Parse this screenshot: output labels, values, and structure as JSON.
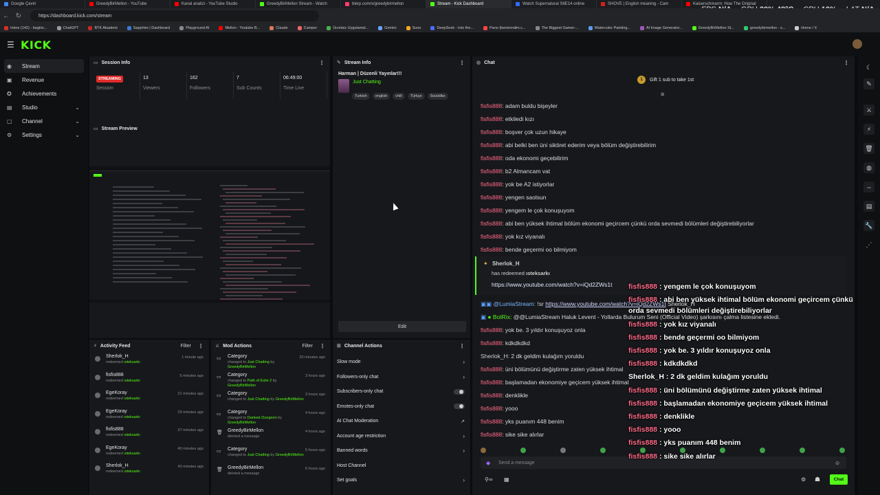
{
  "browser": {
    "tabs": [
      {
        "label": "Google Çeviri",
        "color": "#4285f4",
        "active": false
      },
      {
        "label": "GreedyBirMellon - YouTube",
        "color": "#ff0000",
        "active": false
      },
      {
        "label": "Kanal analizi - YouTube Studio",
        "color": "#ff0000",
        "active": false
      },
      {
        "label": "GreedyBirMellon Stream - Watch",
        "color": "#53fc18",
        "active": false
      },
      {
        "label": "blerp.com/x/greedybirmellon",
        "color": "#ff3d6a",
        "active": false
      },
      {
        "label": "Stream - Kick Dashboard",
        "color": "#53fc18",
        "active": true
      },
      {
        "label": "Watch Supernatural S6E14 online",
        "color": "#2c6cff",
        "active": false
      },
      {
        "label": "SHOVE | English meaning - Cam",
        "color": "#d02020",
        "active": false
      },
      {
        "label": "Kaiserschmarrn: How The Original",
        "color": "#ff0000",
        "active": false
      }
    ],
    "url": "https://dashboard.kick.com/stream",
    "bookmarks": [
      {
        "label": "Inbox (142) - bagiris...",
        "color": "#d93025"
      },
      {
        "label": "ChatGPT",
        "color": "#9a9a9a"
      },
      {
        "label": "BTK Akademi",
        "color": "#c62828"
      },
      {
        "label": "Sapphire | Dashboard",
        "color": "#3a7bd5"
      },
      {
        "label": "Playground AI",
        "color": "#888888"
      },
      {
        "label": "Mellon - Youtube B...",
        "color": "#ff0000"
      },
      {
        "label": "Claude",
        "color": "#d97757"
      },
      {
        "label": "Camper",
        "color": "#e66"
      },
      {
        "label": "Ücretsiz Uygulamal...",
        "color": "#4caf50"
      },
      {
        "label": "Gemini",
        "color": "#6aa0ff"
      },
      {
        "label": "Suno",
        "color": "#f5a623"
      },
      {
        "label": "DeepSeek - Into the...",
        "color": "#4d6bfe"
      },
      {
        "label": "Pano (bentrendim.c...",
        "color": "#ff4444"
      },
      {
        "label": "The Biggest Gamer-...",
        "color": "#888888"
      },
      {
        "label": "Watercolor Painting...",
        "color": "#5c9ded"
      },
      {
        "label": "AI Image Generator...",
        "color": "#9b59b6"
      },
      {
        "label": "GreedyBirMellon St...",
        "color": "#53fc18"
      },
      {
        "label": "greedybirmellon - s...",
        "color": "#2ecc71"
      },
      {
        "label": "Home / X",
        "color": "#cccccc"
      }
    ],
    "perf": {
      "fps_label": "FPS",
      "fps": "N/A",
      "gpu_label": "GPU",
      "gpu": "20% 48°C",
      "cpu_label": "CPU",
      "cpu": "10%",
      "lat_label": "LAT",
      "lat": "N/A"
    }
  },
  "app": {
    "logo": "KICK"
  },
  "sidebar": {
    "items": [
      {
        "label": "Stream",
        "icon": "broadcast-icon",
        "glyph": "◉",
        "chevron": false,
        "active": true
      },
      {
        "label": "Revenue",
        "icon": "revenue-icon",
        "glyph": "▣",
        "chevron": false,
        "active": false
      },
      {
        "label": "Achievements",
        "icon": "trophy-icon",
        "glyph": "✪",
        "chevron": false,
        "active": false
      },
      {
        "label": "Studio",
        "icon": "studio-icon",
        "glyph": "▤",
        "chevron": true,
        "active": false
      },
      {
        "label": "Channel",
        "icon": "channel-icon",
        "glyph": "▢",
        "chevron": true,
        "active": false
      },
      {
        "label": "Settings",
        "icon": "gear-icon",
        "glyph": "⚙",
        "chevron": true,
        "active": false
      }
    ]
  },
  "session": {
    "title": "Session Info",
    "status_badge": "STREAMING",
    "stats": [
      {
        "value": "",
        "label": "Session"
      },
      {
        "value": "13",
        "label": "Viewers"
      },
      {
        "value": "162",
        "label": "Followers"
      },
      {
        "value": "7",
        "label": "Sub Counts"
      },
      {
        "value": "06:49:00",
        "label": "Time Live"
      }
    ]
  },
  "preview": {
    "title": "Stream Preview"
  },
  "stream_info": {
    "title": "Stream Info",
    "stream_title": "Harman | Düzenli Yayınlar!!!",
    "category": "Just Chatting",
    "tags": [
      "Turkish",
      "english",
      "chill",
      "Türkçe",
      "Soulslike"
    ],
    "edit_label": "Edit"
  },
  "activity": {
    "title": "Activity Feed",
    "filter_label": "Filter",
    "rows": [
      {
        "name": "Sherlok_H",
        "action": "redeemed",
        "item": "ısteksarkı",
        "time": "1 minute ago"
      },
      {
        "name": "fisfis888",
        "action": "redeemed",
        "item": "ısteksarkı",
        "time": "5 minutes ago"
      },
      {
        "name": "EgeKoray",
        "action": "redeemed",
        "item": "ısteksarkı",
        "time": "21 minutes ago"
      },
      {
        "name": "EgeKoray",
        "action": "redeemed",
        "item": "ısteksarkı",
        "time": "29 minutes ago"
      },
      {
        "name": "fisfis888",
        "action": "redeemed",
        "item": "ısteksarkı",
        "time": "37 minutes ago"
      },
      {
        "name": "EgeKoray",
        "action": "redeemed",
        "item": "ısteksarkı",
        "time": "40 minutes ago"
      },
      {
        "name": "Sherlok_H",
        "action": "redeemed",
        "item": "ısteksarkı",
        "time": "43 minutes ago"
      }
    ]
  },
  "mod_actions": {
    "title": "Mod Actions",
    "filter_label": "Filter",
    "rows": [
      {
        "title": "Category",
        "pre": "changed to",
        "target": "Just Chatting",
        "mid": "by",
        "by": "GreedyBirMellon",
        "time": "20 minutes ago",
        "icon": "category-icon",
        "glyph": "▭"
      },
      {
        "title": "Category",
        "pre": "changed to",
        "target": "Path of Exile 2",
        "mid": "by",
        "by": "GreedyBirMellon",
        "time": "3 hours ago",
        "icon": "category-icon",
        "glyph": "▭"
      },
      {
        "title": "Category",
        "pre": "changed to",
        "target": "Just Chatting",
        "mid": "by",
        "by": "GreedyBirMellon",
        "time": "3 hours ago",
        "icon": "category-icon",
        "glyph": "▭"
      },
      {
        "title": "Category",
        "pre": "changed to",
        "target": "Darkest Dungeon",
        "mid": "by",
        "by": "GreedyBirMellon",
        "time": "4 hours ago",
        "icon": "category-icon",
        "glyph": "▭"
      },
      {
        "title": "GreedyBirMellon",
        "pre": "deleted a message",
        "target": "",
        "mid": "",
        "by": "",
        "time": "4 hours ago",
        "icon": "trash-icon",
        "glyph": "🗑"
      },
      {
        "title": "Category",
        "pre": "changed to",
        "target": "Just Chatting",
        "mid": "by",
        "by": "GreedyBirMellon",
        "time": "5 hours ago",
        "icon": "category-icon",
        "glyph": "▭"
      },
      {
        "title": "GreedyBirMellon",
        "pre": "deleted a message",
        "target": "",
        "mid": "",
        "by": "",
        "time": "6 hours ago",
        "icon": "trash-icon",
        "glyph": "🗑"
      }
    ]
  },
  "channel_actions": {
    "title": "Channel Actions",
    "rows": [
      {
        "label": "Slow mode",
        "control": "arrow"
      },
      {
        "label": "Followers-only chat",
        "control": "arrow"
      },
      {
        "label": "Subscribers-only chat",
        "control": "toggle"
      },
      {
        "label": "Emotes-only chat",
        "control": "toggle"
      },
      {
        "label": "AI Chat Moderation",
        "control": "external"
      },
      {
        "label": "Account age restriction",
        "control": "arrow"
      },
      {
        "label": "Banned words",
        "control": "arrow"
      },
      {
        "label": "Host Channel",
        "control": "none"
      },
      {
        "label": "Set goals",
        "control": "arrow"
      }
    ]
  },
  "chat": {
    "title": "Chat",
    "gift_count": "1",
    "gift_text": "Gift 1 sub to take 1st",
    "messages": [
      {
        "user": "fisfis888",
        "text": "adam buldu bişeyler"
      },
      {
        "user": "fisfis888",
        "text": "etkiledi kızı"
      },
      {
        "user": "fisfis888",
        "text": "boşver çok uzun hikaye"
      },
      {
        "user": "fisfis888",
        "text": "abi belki ben üni siktiret ederim veya bölüm değiştirebilirim"
      },
      {
        "user": "fisfis888",
        "text": "oda ekonomi geçebilirim"
      },
      {
        "user": "fisfis888",
        "text": "b2 Almancam vat"
      },
      {
        "user": "fisfis888",
        "text": "yok be A2 istiyorlar"
      },
      {
        "user": "fisfis888",
        "text": "yengen saolsun"
      },
      {
        "user": "fisfis888",
        "text": "yengem le çok konuşuyom"
      },
      {
        "user": "fisfis888",
        "text": "abi ben yüksek ihtimal bölüm ekonomi geçircem çünkü orda sevmedi bölümleri değiştirebiliyorlar"
      },
      {
        "user": "fisfis888",
        "text": "yok kız viyanalı"
      },
      {
        "user": "fisfis888",
        "text": "bende geçermi oo bilmiyom"
      }
    ],
    "redeem": {
      "user": "Sherlok_H",
      "line": "has redeemed",
      "reward": "ısteksarkı",
      "link": "https://www.youtube.com/watch?v=iQd2ZWs1t"
    },
    "lumia": {
      "user": "@LumiaStream:",
      "cmd": "!sr",
      "link": "https://www.youtube.com/watch?v=iQd2ZWs1t",
      "tail": "Sherlok_H"
    },
    "botrix": {
      "user": "BotRix:",
      "text": "@@LumiaStream Haluk Levent - Yollarda Bulurum Seni (Official Video) şarkısını çalma listesine ekledi."
    },
    "messages2": [
      {
        "user": "fisfis888",
        "text": "yok be. 3 yıldır konuşuyoz onla",
        "cls": "u"
      },
      {
        "user": "fisfis888",
        "text": "kdkdkdkd",
        "cls": "u"
      },
      {
        "user": "Sherlok_H:",
        "text": "2 dk geldim kulağım yoruldu",
        "cls": "u2"
      },
      {
        "user": "fisfis888",
        "text": "üni bölümünü değiştirme zaten yüksek ihtimal",
        "cls": "u"
      },
      {
        "user": "fisfis888",
        "text": "başlamadan ekonomiye geçicem yüksek ihtimal",
        "cls": "u"
      },
      {
        "user": "fisfis888",
        "text": "denklikle",
        "cls": "u"
      },
      {
        "user": "fisfis888",
        "text": "yooo",
        "cls": "u"
      },
      {
        "user": "fisfis888",
        "text": "yks puanım 448 benim",
        "cls": "u"
      },
      {
        "user": "fisfis888",
        "text": "sike sike alırlar",
        "cls": "u"
      }
    ],
    "input_placeholder": "Send a message",
    "send_label": "Chat"
  },
  "overlay": {
    "messages": [
      {
        "user": "fisfis888",
        "text": " : yengem le çok konuşuyom"
      },
      {
        "user": "fisfis888",
        "text": " : abi ben yüksek ihtimal bölüm ekonomi geçircem çünkü"
      },
      {
        "user": "",
        "text": "orda sevmedi bölümleri değiştirebiliyorlar"
      },
      {
        "user": "fisfis888",
        "text": " : yok kız viyanalı"
      },
      {
        "user": "fisfis888",
        "text": " : bende geçermi oo bilmiyom"
      },
      {
        "user": "fisfis888",
        "text": " : yok be. 3 yıldır konuşuyoz onla"
      },
      {
        "user": "fisfis888",
        "text": " : kdkdkdkd"
      },
      {
        "user": "Sherlok_H",
        "text": " : 2 dk geldim kulağım yoruldu",
        "white": true
      },
      {
        "user": "fisfis888",
        "text": " : üni bölümünü değiştirme zaten yüksek ihtimal"
      },
      {
        "user": "fisfis888",
        "text": " : başlamadan ekonomiye geçicem yüksek ihtimal"
      },
      {
        "user": "fisfis888",
        "text": " : denklikle"
      },
      {
        "user": "fisfis888",
        "text": " : yooo"
      },
      {
        "user": "fisfis888",
        "text": " : yks puanım 448 benim"
      },
      {
        "user": "fisfis888",
        "text": " : sike sike alırlar"
      }
    ]
  },
  "rail": {
    "icons": [
      "moon-icon",
      "edit-icon",
      "sword-icon",
      "lightning-icon",
      "trash-icon",
      "chat-bubble-icon",
      "link-icon",
      "calendar-icon",
      "wrench-icon",
      "nodes-icon"
    ]
  },
  "colors": {
    "accent": "#53fc18",
    "username": "#ff6b8a",
    "live": "#e02a2a"
  }
}
